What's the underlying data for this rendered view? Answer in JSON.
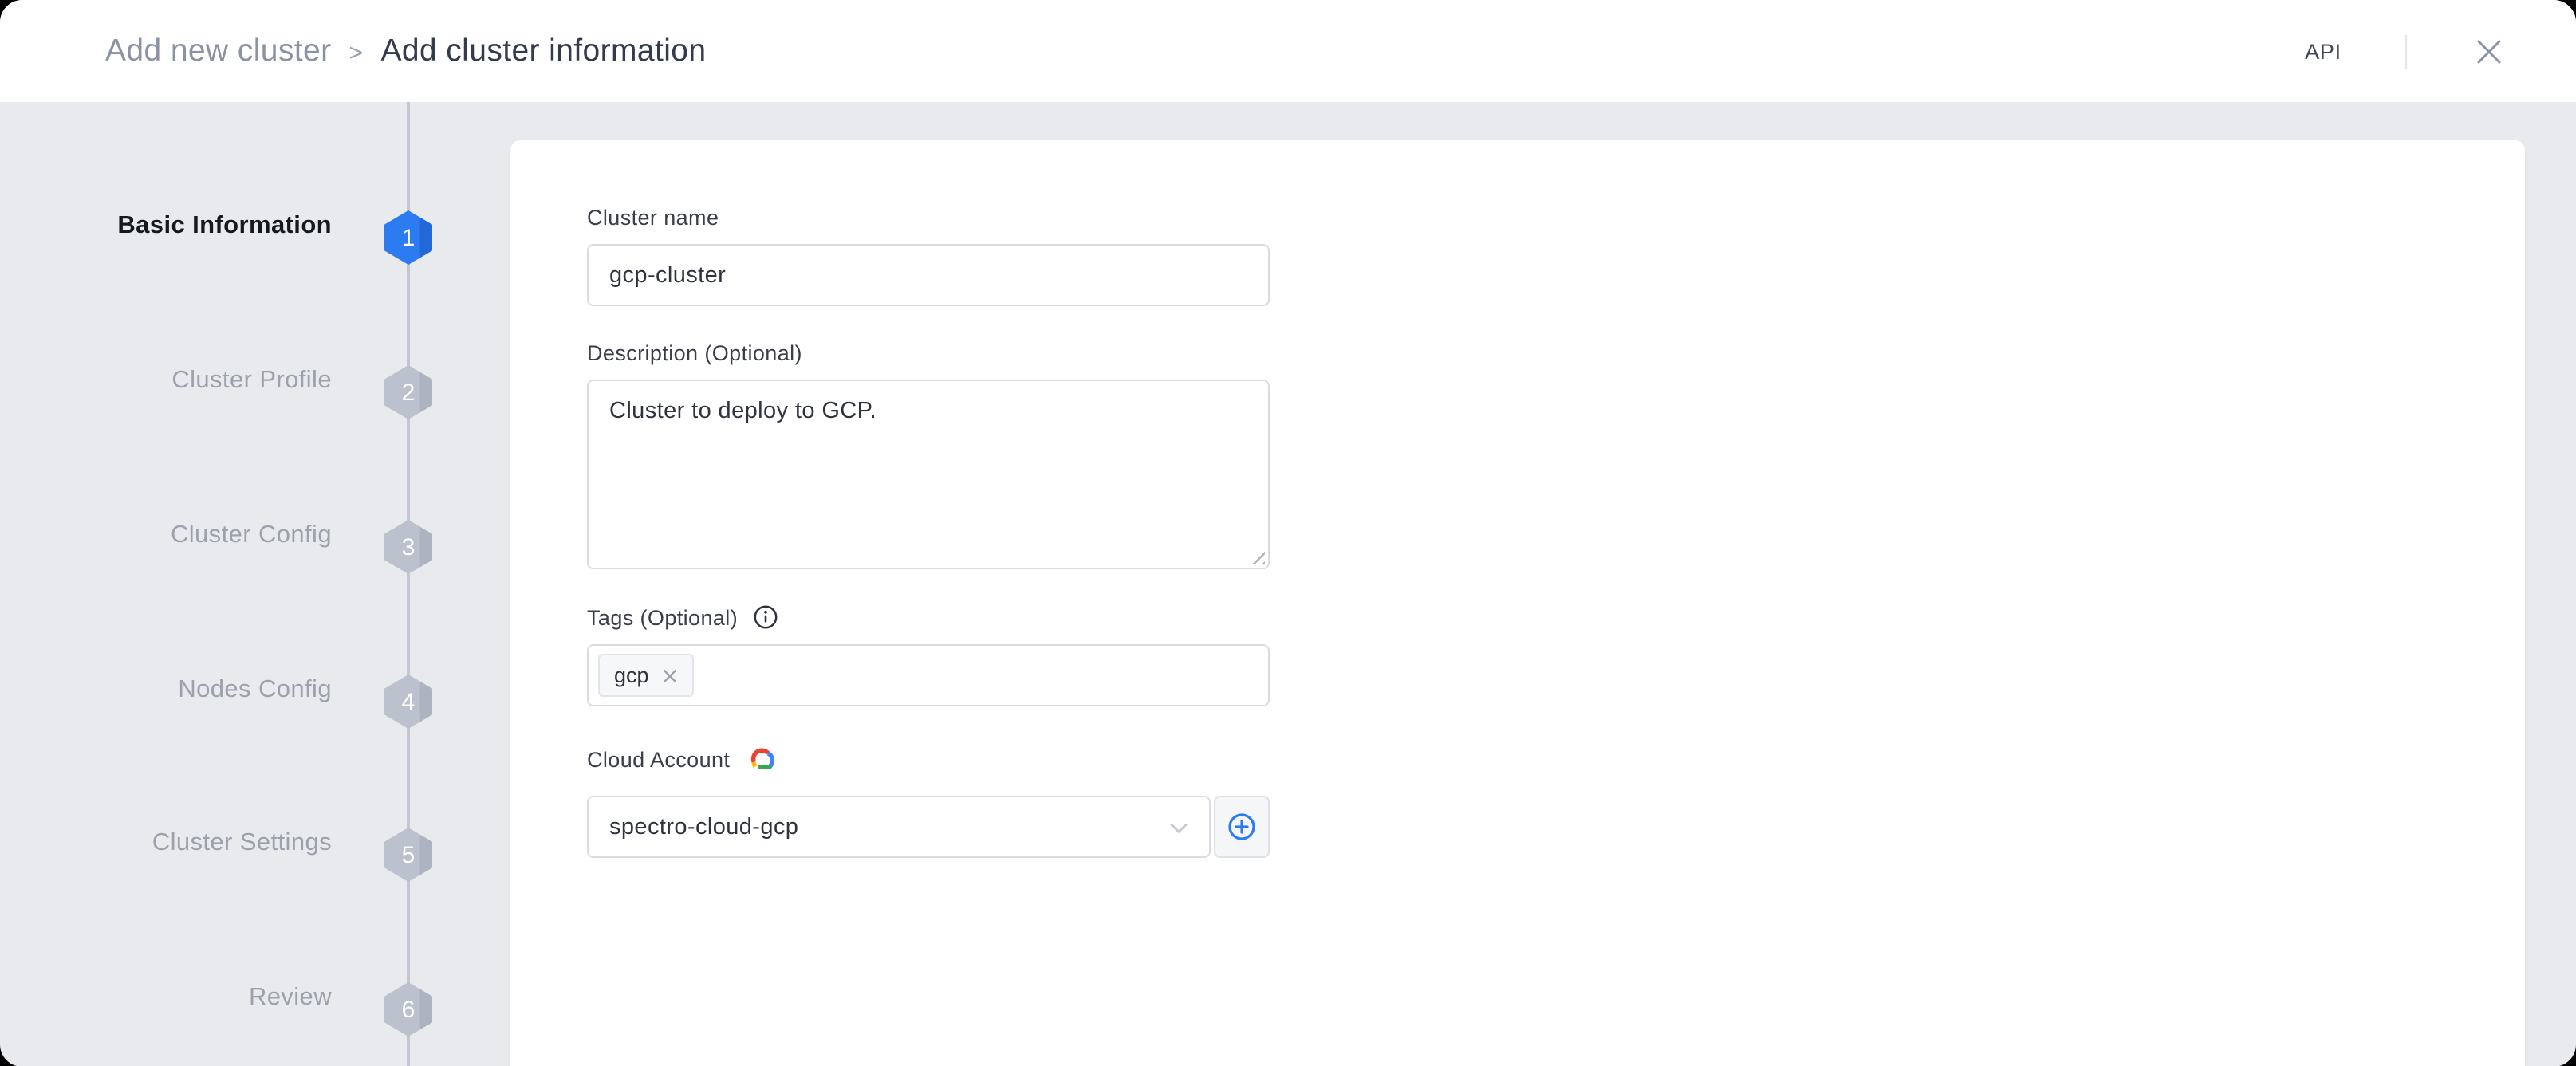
{
  "header": {
    "breadcrumb": {
      "parent": "Add new cluster",
      "separator": ">",
      "current": "Add cluster information"
    },
    "api_label": "API",
    "icons": {
      "close": "close-x"
    }
  },
  "stepper": {
    "steps": [
      {
        "number": "1",
        "label": "Basic Information",
        "state": "active"
      },
      {
        "number": "2",
        "label": "Cluster Profile",
        "state": "upcoming"
      },
      {
        "number": "3",
        "label": "Cluster Config",
        "state": "upcoming"
      },
      {
        "number": "4",
        "label": "Nodes Config",
        "state": "upcoming"
      },
      {
        "number": "5",
        "label": "Cluster Settings",
        "state": "upcoming"
      },
      {
        "number": "6",
        "label": "Review",
        "state": "upcoming"
      }
    ]
  },
  "form": {
    "cluster_name": {
      "label": "Cluster name",
      "value": "gcp-cluster"
    },
    "description": {
      "label": "Description (Optional)",
      "value": "Cluster to deploy to GCP."
    },
    "tags": {
      "label": "Tags (Optional)",
      "info_icon": "info-circle",
      "chips": [
        {
          "text": "gcp",
          "remove_icon": "close-x-small"
        }
      ]
    },
    "cloud_account": {
      "label": "Cloud Account",
      "provider_icon": "google-cloud",
      "selected_value": "spectro-cloud-gcp",
      "dropdown_icon": "chevron-down",
      "add_button_icon": "plus-circle"
    }
  },
  "colors": {
    "accent_blue": "#2C7BF0",
    "step_inactive": "#BCC2CD",
    "background_gray": "#E9EAEE",
    "gcp_red": "#EA4335",
    "gcp_yellow": "#FBBC05",
    "gcp_blue": "#4285F4",
    "gcp_green": "#34A853"
  }
}
